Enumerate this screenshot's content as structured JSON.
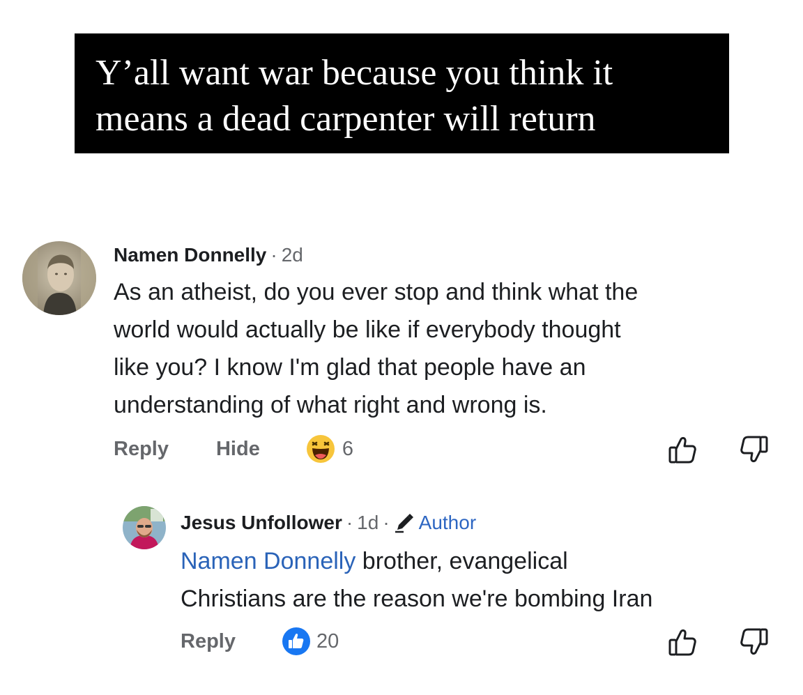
{
  "post": {
    "text": "Y’all want war because you think it\nmeans a dead carpenter will return"
  },
  "comments": [
    {
      "author": "Namen Donnelly",
      "separator": "·",
      "time": "2d",
      "body": "As an atheist, do you ever stop and think what the\nworld would actually be like if everybody thought\nlike you?  I know I'm glad that people have an\nunderstanding of what right and wrong is.",
      "actions": {
        "reply": "Reply",
        "hide": "Hide"
      },
      "reaction": {
        "icon": "haha-emoji-icon",
        "count": "6"
      }
    }
  ],
  "reply": {
    "author": "Jesus Unfollower",
    "separator": "·",
    "time": "1d",
    "badge_label": "Author",
    "badge_icon": "pencil-icon",
    "mention": "Namen Donnelly",
    "body_line1_rest": " brother, evangelical",
    "body_line2": "Christians are the reason we're bombing Iran",
    "actions": {
      "reply": "Reply"
    },
    "reaction": {
      "icon": "like-icon",
      "count": "20"
    }
  },
  "colors": {
    "accent_blue": "#2d66c2",
    "like_blue": "#1877f2",
    "muted_text": "#65676b"
  }
}
